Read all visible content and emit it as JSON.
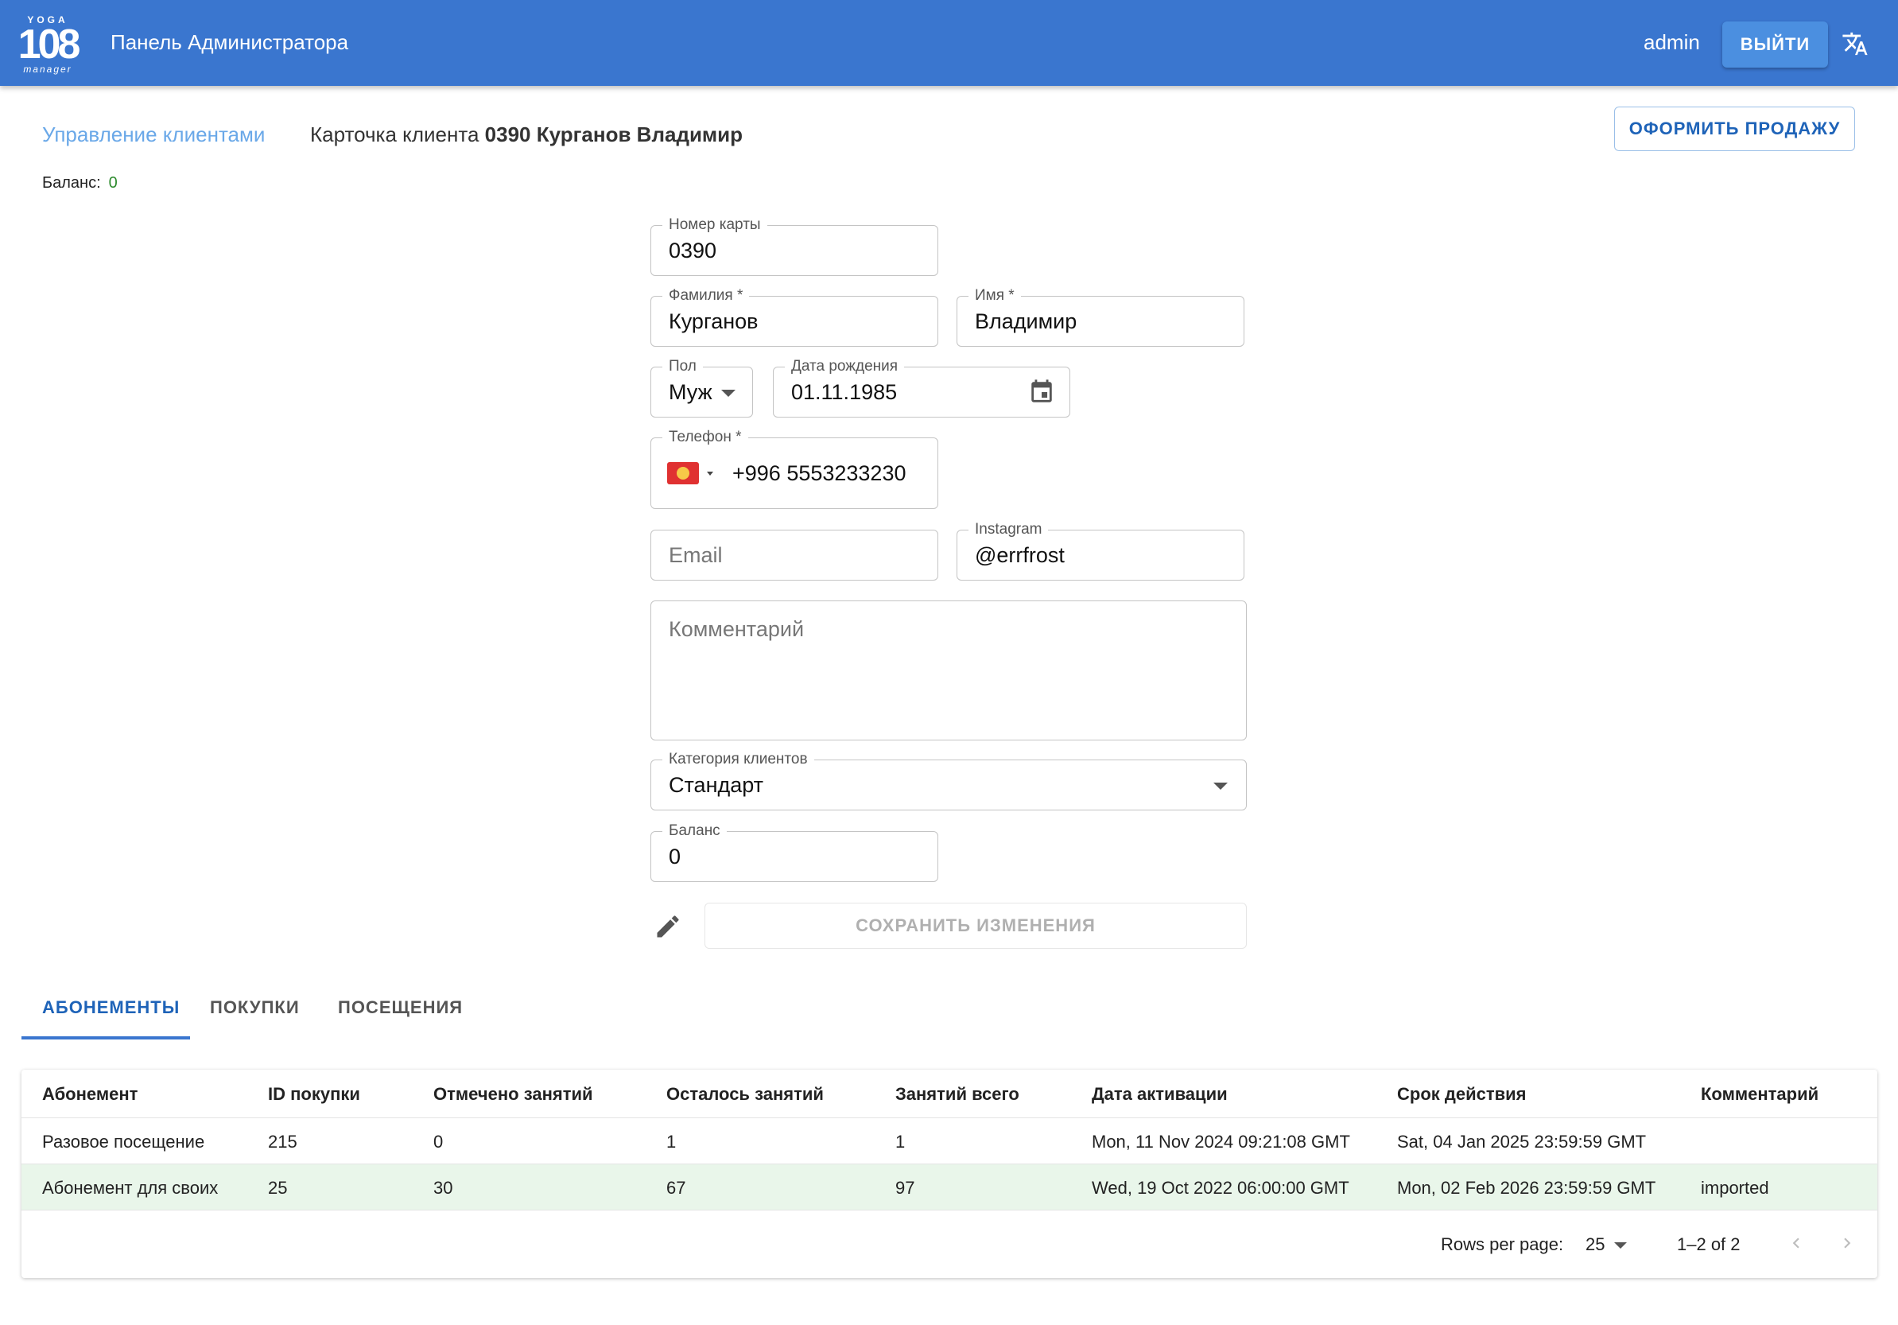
{
  "header": {
    "logo": {
      "top": "YOGA",
      "number": "108",
      "bottom": "manager"
    },
    "title": "Панель Администратора",
    "user": "admin",
    "logout_label": "ВЫЙТИ",
    "translate_icon": "translate-icon"
  },
  "breadcrumb": {
    "link": "Управление клиентами",
    "current_prefix": "Карточка клиента",
    "current_name": "0390 Курганов Владимир"
  },
  "actions": {
    "sale_label": "ОФОРМИТЬ ПРОДАЖУ"
  },
  "balance_summary": {
    "label": "Баланс:",
    "value": "0"
  },
  "form": {
    "card_number": {
      "label": "Номер карты",
      "value": "0390"
    },
    "last_name": {
      "label": "Фамилия *",
      "value": "Курганов"
    },
    "first_name": {
      "label": "Имя *",
      "value": "Владимир"
    },
    "gender": {
      "label": "Пол",
      "value": "Муж"
    },
    "birth_date": {
      "label": "Дата рождения",
      "value": "01.11.1985"
    },
    "phone": {
      "label": "Телефон *",
      "value": "+996 5553233230",
      "flag": "KG"
    },
    "email": {
      "placeholder": "Email"
    },
    "instagram": {
      "label": "Instagram",
      "value": "@errfrost"
    },
    "comment": {
      "placeholder": "Комментарий"
    },
    "category": {
      "label": "Категория клиентов",
      "value": "Стандарт"
    },
    "balance": {
      "label": "Баланс",
      "value": "0"
    },
    "save_label": "СОХРАНИТЬ ИЗМЕНЕНИЯ"
  },
  "tabs": [
    {
      "label": "АБОНЕМЕНТЫ",
      "active": true
    },
    {
      "label": "ПОКУПКИ",
      "active": false
    },
    {
      "label": "ПОСЕЩЕНИЯ",
      "active": false
    }
  ],
  "table": {
    "columns": [
      "Абонемент",
      "ID покупки",
      "Отмечено занятий",
      "Осталось занятий",
      "Занятий всего",
      "Дата активации",
      "Срок действия",
      "Комментарий"
    ],
    "rows": [
      [
        "Разовое посещение",
        "215",
        "0",
        "1",
        "1",
        "Mon, 11 Nov 2024 09:21:08 GMT",
        "Sat, 04 Jan 2025 23:59:59 GMT",
        ""
      ],
      [
        "Абонемент для своих",
        "25",
        "30",
        "67",
        "97",
        "Wed, 19 Oct 2022 06:00:00 GMT",
        "Mon, 02 Feb 2026 23:59:59 GMT",
        "imported"
      ]
    ],
    "rows_per_page_label": "Rows per page:",
    "rows_per_page": "25",
    "range": "1–2 of 2"
  },
  "colors": {
    "appbar": "#3a76cf",
    "accent": "#1e63b8",
    "balance_value": "#2e8b2e",
    "highlight_row": "#e9f6ea"
  }
}
